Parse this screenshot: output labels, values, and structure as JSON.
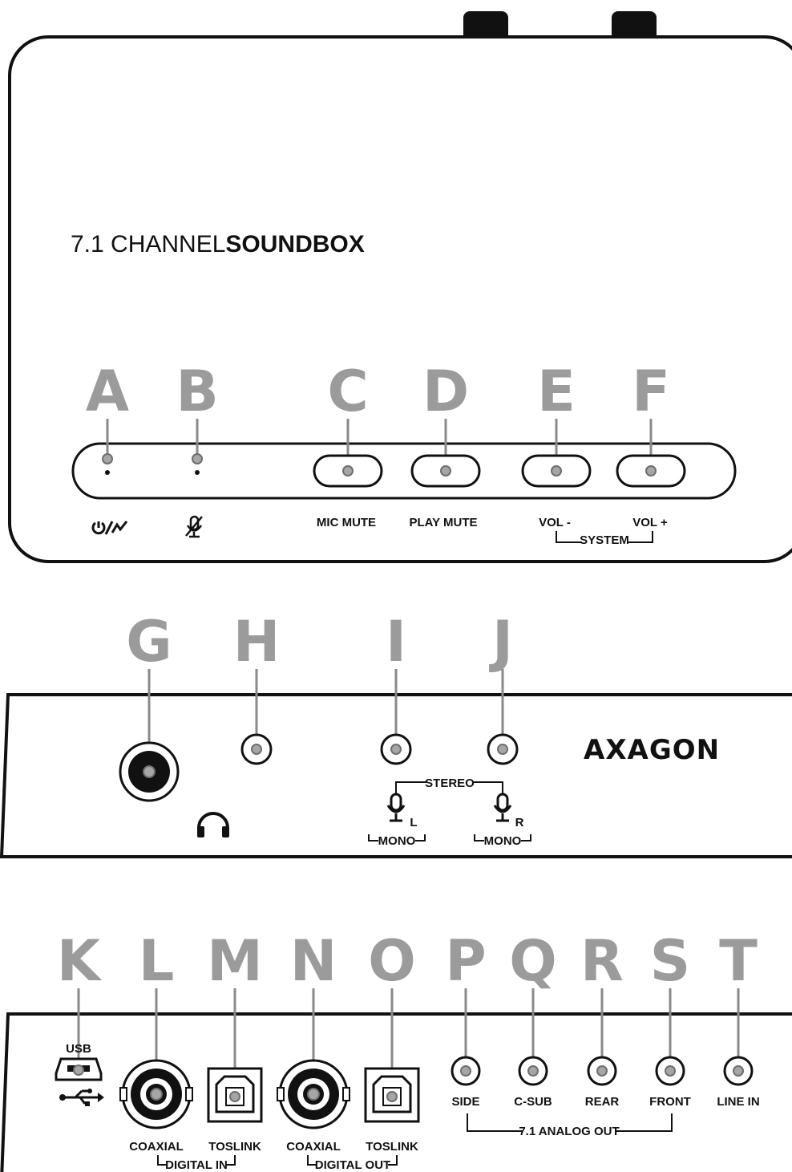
{
  "product": {
    "line_light": "7.1 CHANNEL",
    "line_bold": "SOUNDBOX"
  },
  "brand": "AXAGON",
  "top_panel": {
    "callouts": [
      "A",
      "B",
      "C",
      "D",
      "E",
      "F"
    ],
    "labels": {
      "mic_mute": "MIC MUTE",
      "play_mute": "PLAY MUTE",
      "vol_minus": "VOL -",
      "vol_plus": "VOL +",
      "system": "SYSTEM"
    },
    "icons": [
      "power-usb-icon",
      "mic-muted-icon"
    ]
  },
  "front_panel": {
    "callouts": [
      "G",
      "H",
      "I",
      "J"
    ],
    "labels": {
      "stereo": "STEREO",
      "mono": "MONO",
      "left": "L",
      "right": "R"
    },
    "icons": [
      "headphones-icon",
      "microphone-icon"
    ]
  },
  "rear_panel": {
    "callouts": [
      "K",
      "L",
      "M",
      "N",
      "O",
      "P",
      "Q",
      "R",
      "S",
      "T"
    ],
    "labels": {
      "usb": "USB",
      "coaxial_in": "COAXIAL",
      "toslink_in": "TOSLINK",
      "digital_in": "DIGITAL IN",
      "coaxial_out": "COAXIAL",
      "toslink_out": "TOSLINK",
      "digital_out": "DIGITAL OUT",
      "side": "SIDE",
      "csub": "C-SUB",
      "rear": "REAR",
      "front": "FRONT",
      "line_in": "LINE IN",
      "analog_out": "7.1 ANALOG OUT"
    },
    "icons": [
      "usb-port-icon",
      "usb-symbol-icon"
    ]
  }
}
